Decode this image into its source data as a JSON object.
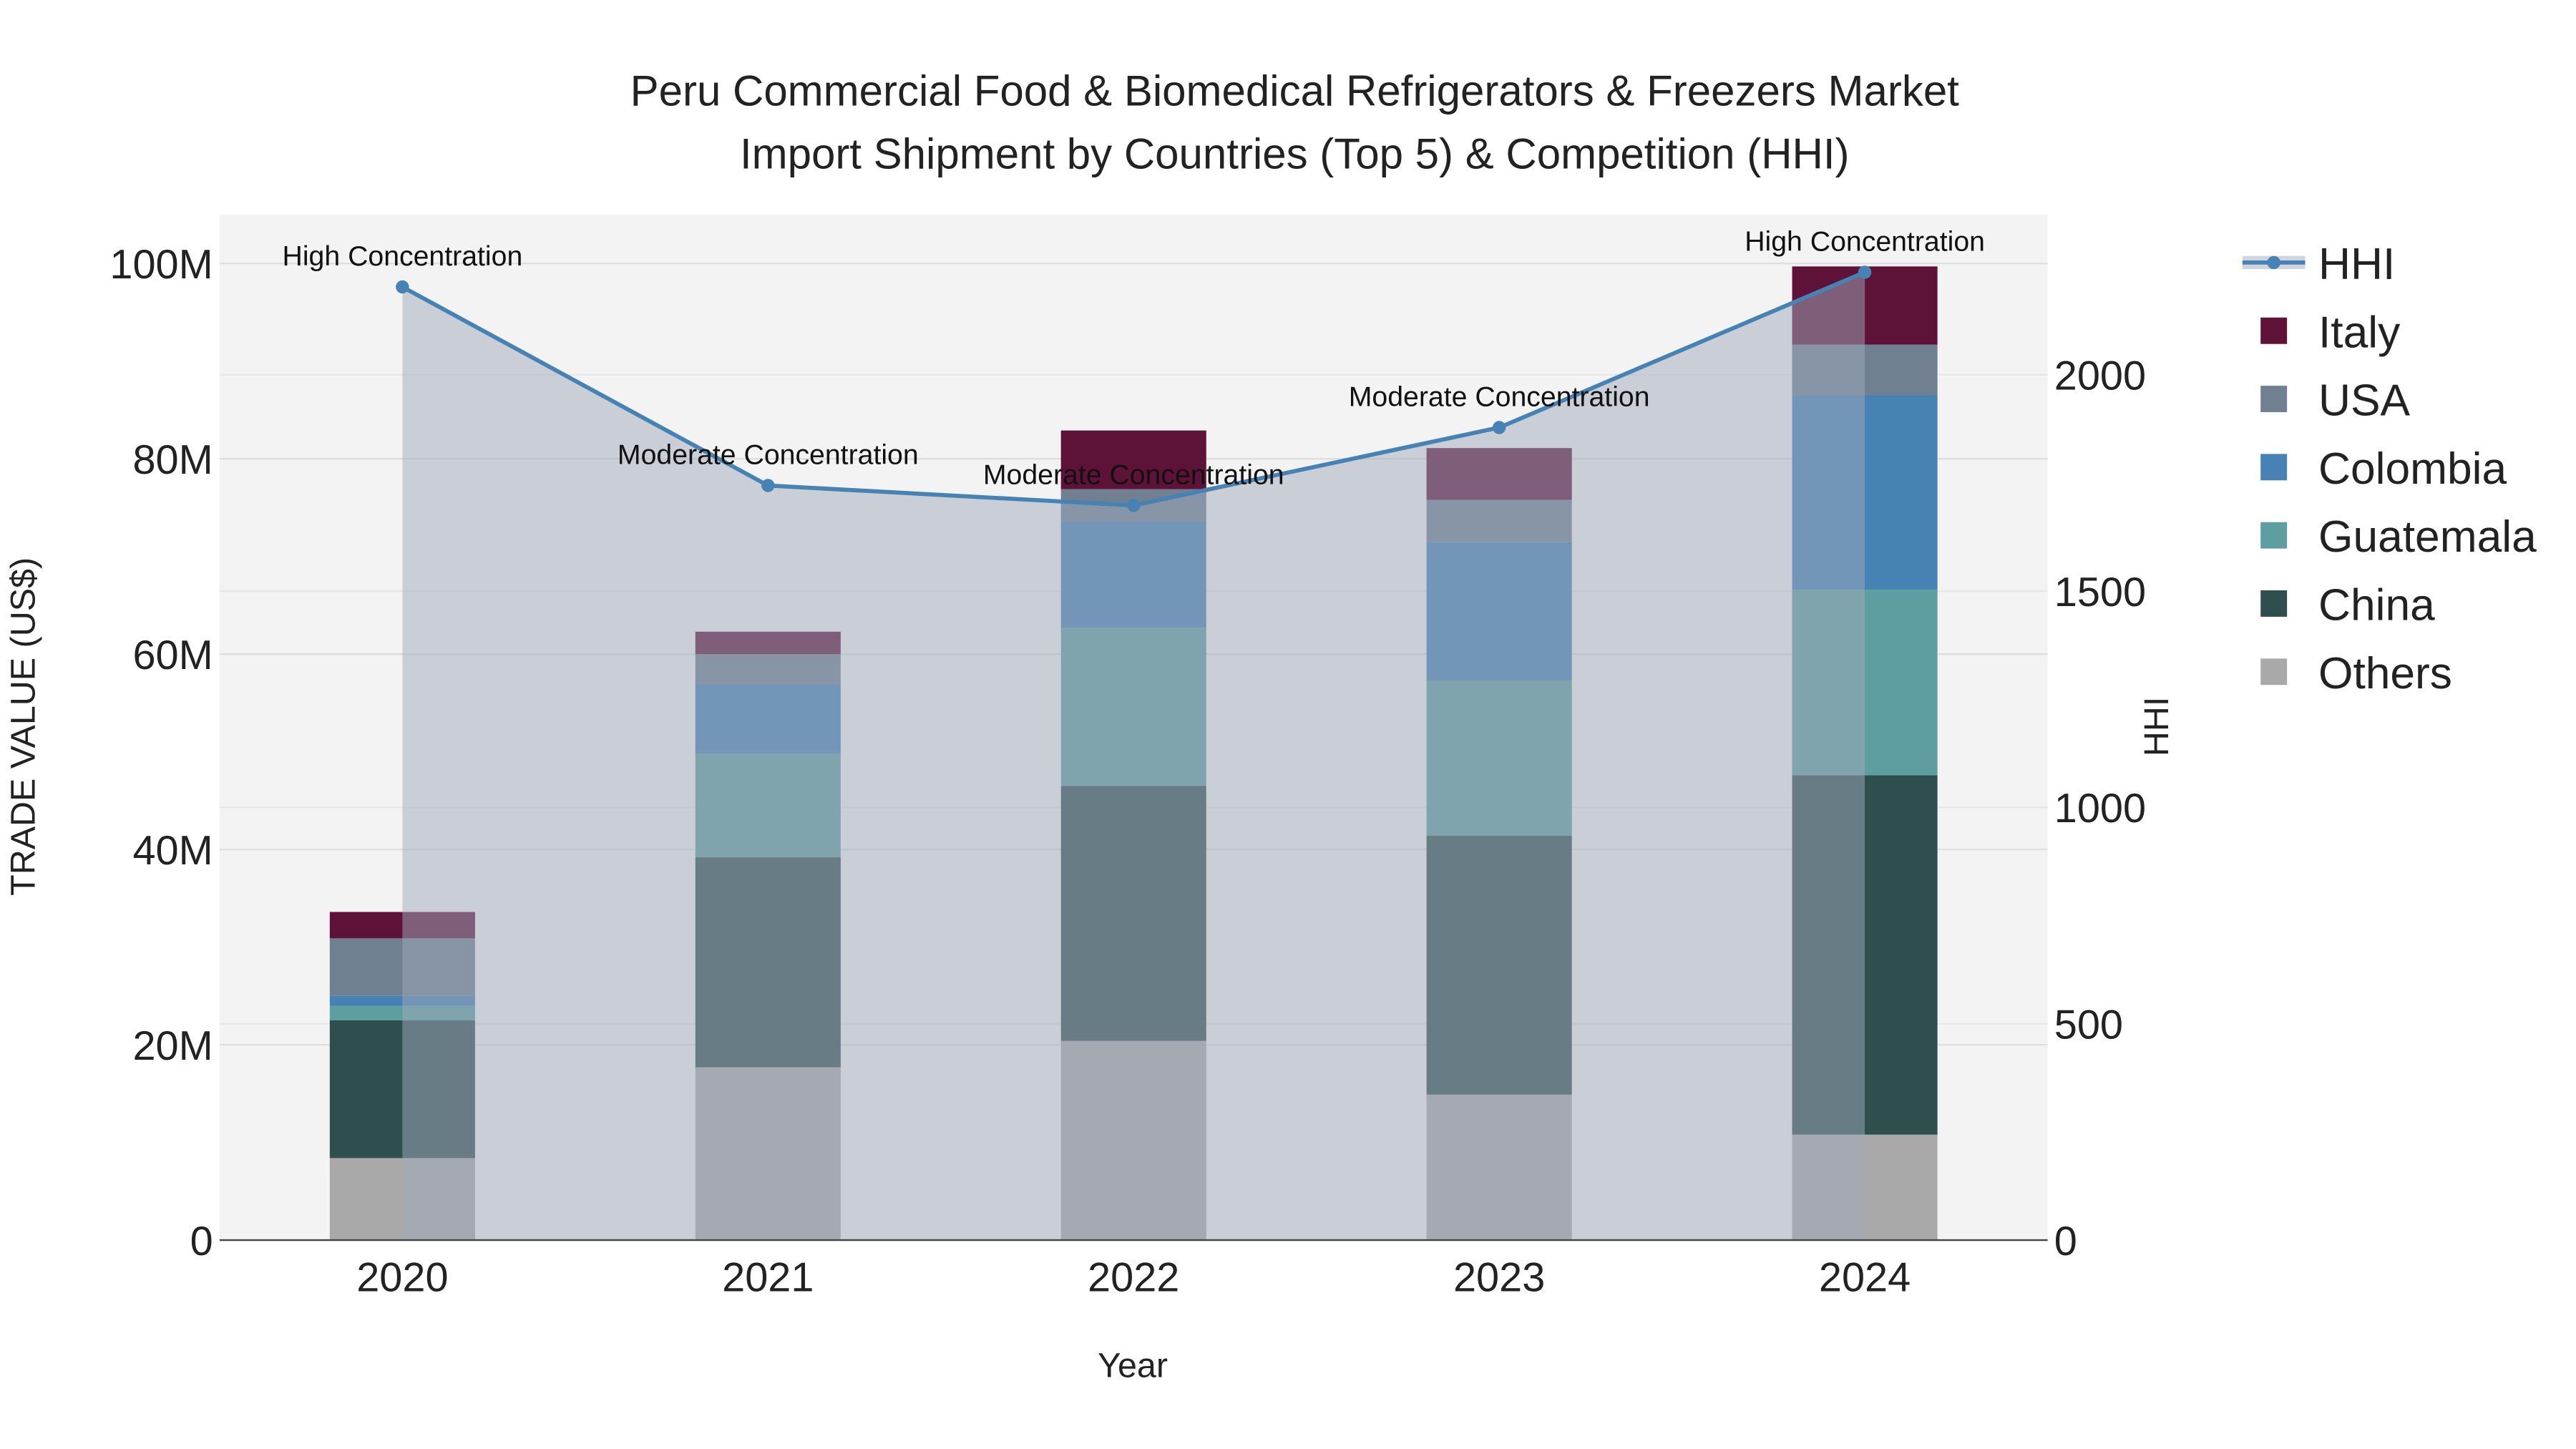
{
  "chart_data": {
    "type": "bar",
    "title_line1": "Peru Commercial Food & Biomedical Refrigerators & Freezers Market",
    "title_line2": "Import Shipment by Countries (Top 5) & Competition (HHI)",
    "xlabel": "Year",
    "ylabel": "TRADE VALUE (US$)",
    "y2label": "HHI",
    "categories": [
      "2020",
      "2021",
      "2022",
      "2023",
      "2024"
    ],
    "ylim": [
      0,
      105
    ],
    "y_ticks": [
      0,
      20,
      40,
      60,
      80,
      100
    ],
    "y_tick_labels": [
      "0",
      "20M",
      "40M",
      "60M",
      "80M",
      "100M"
    ],
    "y2lim": [
      0,
      2370
    ],
    "y2_ticks": [
      0,
      500,
      1000,
      1500,
      2000
    ],
    "y2_tick_labels": [
      "0",
      "500",
      "1000",
      "1500",
      "2000"
    ],
    "units": "US$ millions",
    "series": [
      {
        "name": "Others",
        "color": "#a9a9a9",
        "values": [
          8.4,
          17.7,
          20.4,
          14.9,
          10.8
        ]
      },
      {
        "name": "China",
        "color": "#2f4f4f",
        "values": [
          14.1,
          21.5,
          26.1,
          26.5,
          36.8
        ]
      },
      {
        "name": "Guatemala",
        "color": "#5f9ea0",
        "values": [
          1.5,
          10.6,
          16.2,
          15.9,
          19.0
        ]
      },
      {
        "name": "Colombia",
        "color": "#4682b4",
        "values": [
          1.0,
          7.1,
          10.9,
          14.2,
          19.9
        ]
      },
      {
        "name": "USA",
        "color": "#708090",
        "values": [
          5.9,
          3.1,
          3.3,
          4.3,
          5.2
        ]
      },
      {
        "name": "Italy",
        "color": "#5f1238",
        "values": [
          2.7,
          2.3,
          6.0,
          5.3,
          8.0
        ]
      }
    ],
    "hhi": {
      "name": "HHI",
      "color": "#4682b4",
      "values": [
        2203,
        1744,
        1698,
        1878,
        2237
      ],
      "annotations": [
        "High Concentration",
        "Moderate Concentration",
        "Moderate Concentration",
        "Moderate Concentration",
        "High Concentration"
      ]
    },
    "legend_order": [
      "HHI",
      "Italy",
      "USA",
      "Colombia",
      "Guatemala",
      "China",
      "Others"
    ],
    "legend_position": "right",
    "grid": true
  }
}
